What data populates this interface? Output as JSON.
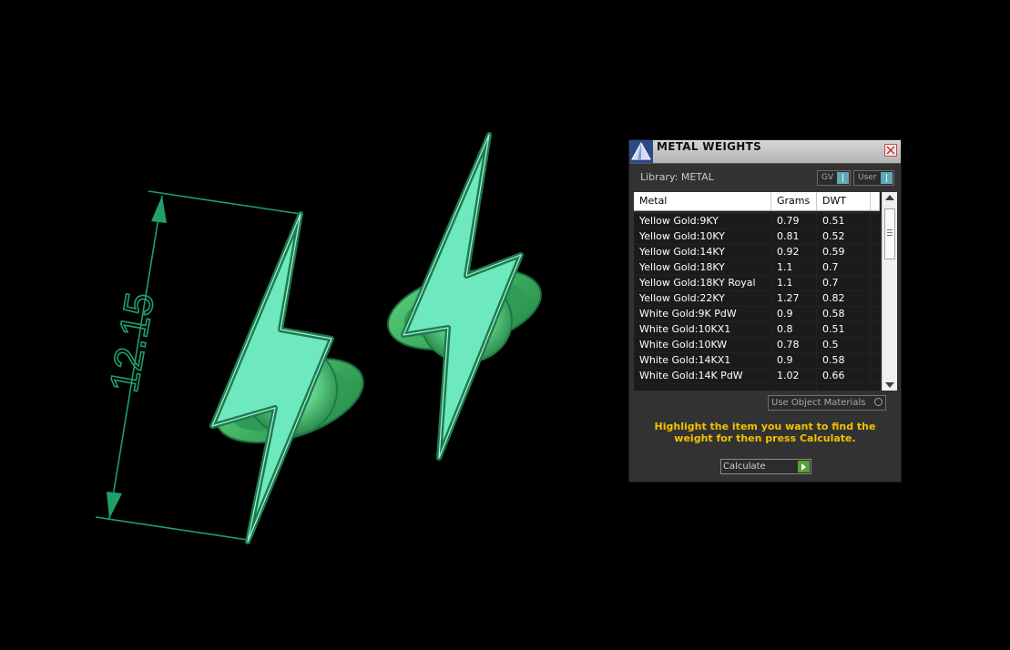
{
  "dimension": {
    "value": "12.15",
    "color": "#1fa06a"
  },
  "colors": {
    "model_face": "#6ee8bf",
    "model_edge": "#1f7a4e",
    "band_green": "#36b062",
    "accent_yellow": "#f2c200"
  },
  "panel": {
    "title": "METAL WEIGHTS",
    "logo_icon": "pyramid-logo-icon",
    "close_icon": "close-icon",
    "library_label": "Library: METAL",
    "gv_label": "GV",
    "user_label": "User",
    "columns": {
      "metal": "Metal",
      "grams": "Grams",
      "dwt": "DWT"
    },
    "rows": [
      {
        "metal": "Yellow Gold:9KY",
        "grams": "0.79",
        "dwt": "0.51"
      },
      {
        "metal": "Yellow Gold:10KY",
        "grams": "0.81",
        "dwt": "0.52"
      },
      {
        "metal": "Yellow Gold:14KY",
        "grams": "0.92",
        "dwt": "0.59"
      },
      {
        "metal": "Yellow Gold:18KY",
        "grams": "1.1",
        "dwt": "0.7"
      },
      {
        "metal": "Yellow Gold:18KY Royal",
        "grams": "1.1",
        "dwt": "0.7"
      },
      {
        "metal": "Yellow Gold:22KY",
        "grams": "1.27",
        "dwt": "0.82"
      },
      {
        "metal": "White Gold:9K PdW",
        "grams": "0.9",
        "dwt": "0.58"
      },
      {
        "metal": "White Gold:10KX1",
        "grams": "0.8",
        "dwt": "0.51"
      },
      {
        "metal": "White Gold:10KW",
        "grams": "0.78",
        "dwt": "0.5"
      },
      {
        "metal": "White Gold:14KX1",
        "grams": "0.9",
        "dwt": "0.58"
      },
      {
        "metal": "White Gold:14K PdW",
        "grams": "1.02",
        "dwt": "0.66"
      }
    ],
    "use_object_materials": "Use Object Materials",
    "instruction": "Highlight the item you want to find the weight for then press Calculate.",
    "calculate_label": "Calculate"
  }
}
